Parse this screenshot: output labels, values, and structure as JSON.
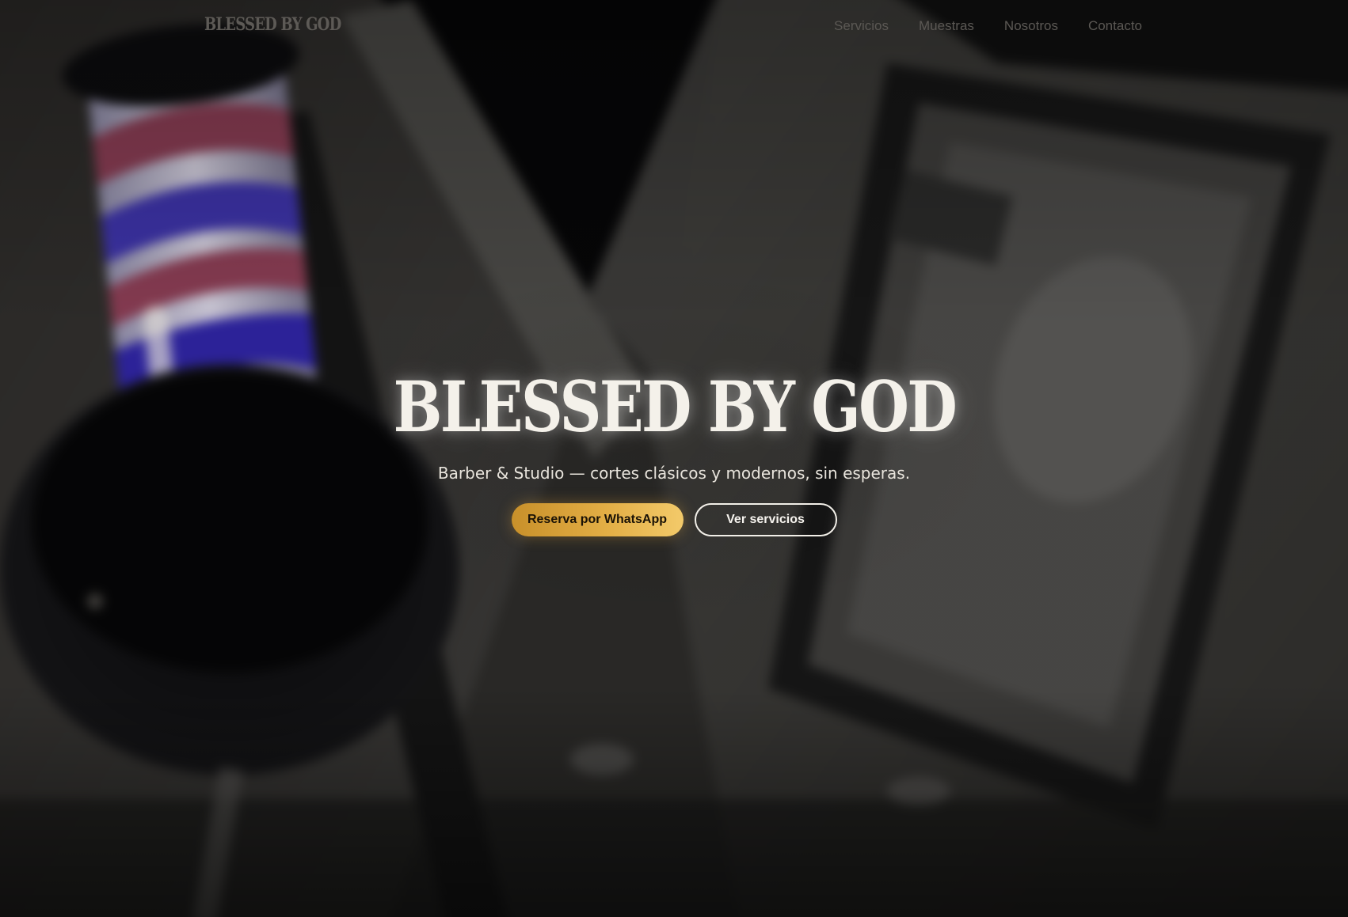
{
  "colors": {
    "accent_gold": "#e3ae45",
    "title_white": "#f4f1ea",
    "nav_text": "#5b5854",
    "pole_blue": "#3d33a8",
    "pole_red": "#8a3d54"
  },
  "nav": {
    "brand": "BLESSED BY GOD",
    "links": [
      "Servicios",
      "Muestras",
      "Nosotros",
      "Contacto"
    ]
  },
  "hero": {
    "background_image": "barber-pole-photo",
    "title": "BLESSED BY GOD",
    "subtitle": "Barber & Studio — cortes clásicos y modernos, sin esperas.",
    "primary_cta": "Reserva por WhatsApp",
    "secondary_cta": "Ver servicios"
  }
}
